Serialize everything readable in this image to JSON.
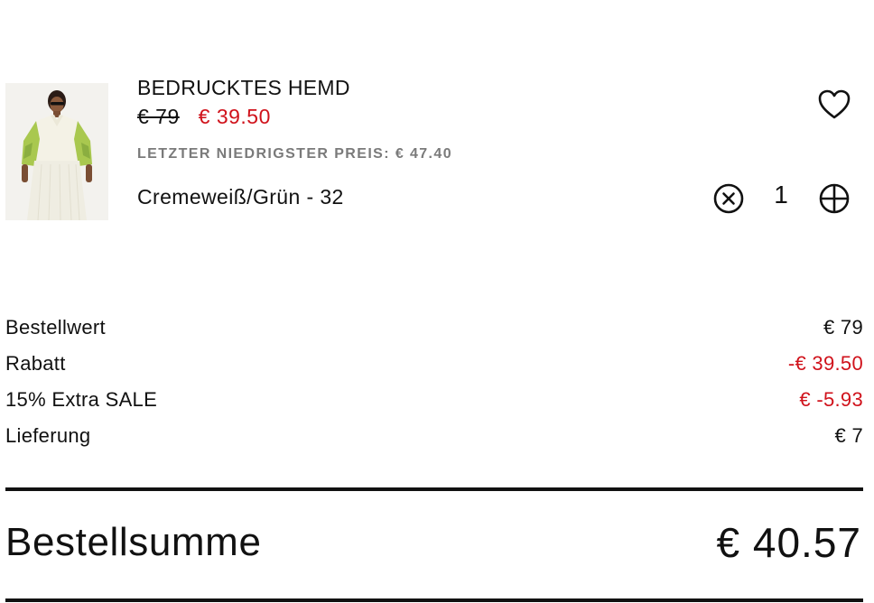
{
  "product": {
    "name": "BEDRUCKTES HEMD",
    "price_original": "€ 79",
    "price_sale": "€ 39.50",
    "lowest_price_note": "LETZTER NIEDRIGSTER PREIS: € 47.40",
    "variant": "Cremeweiß/Grün - 32",
    "quantity": "1",
    "image_icon": "product-thumbnail",
    "wishlist_icon": "heart-outline-icon",
    "decrease_icon": "circle-x-icon",
    "increase_icon": "circle-plus-icon"
  },
  "summary": {
    "rows": [
      {
        "label": "Bestellwert",
        "value": "€ 79",
        "color": "#111111"
      },
      {
        "label": "Rabatt",
        "value": "-€ 39.50",
        "color": "#d0121b"
      },
      {
        "label": "15% Extra SALE",
        "value": "€ -5.93",
        "color": "#d0121b"
      },
      {
        "label": "Lieferung",
        "value": "€ 7",
        "color": "#111111"
      }
    ],
    "total_label": "Bestellsumme",
    "total_value": "€ 40.57"
  },
  "colors": {
    "sale_red": "#d0121b",
    "text": "#111111",
    "muted": "#7a7a7a"
  }
}
